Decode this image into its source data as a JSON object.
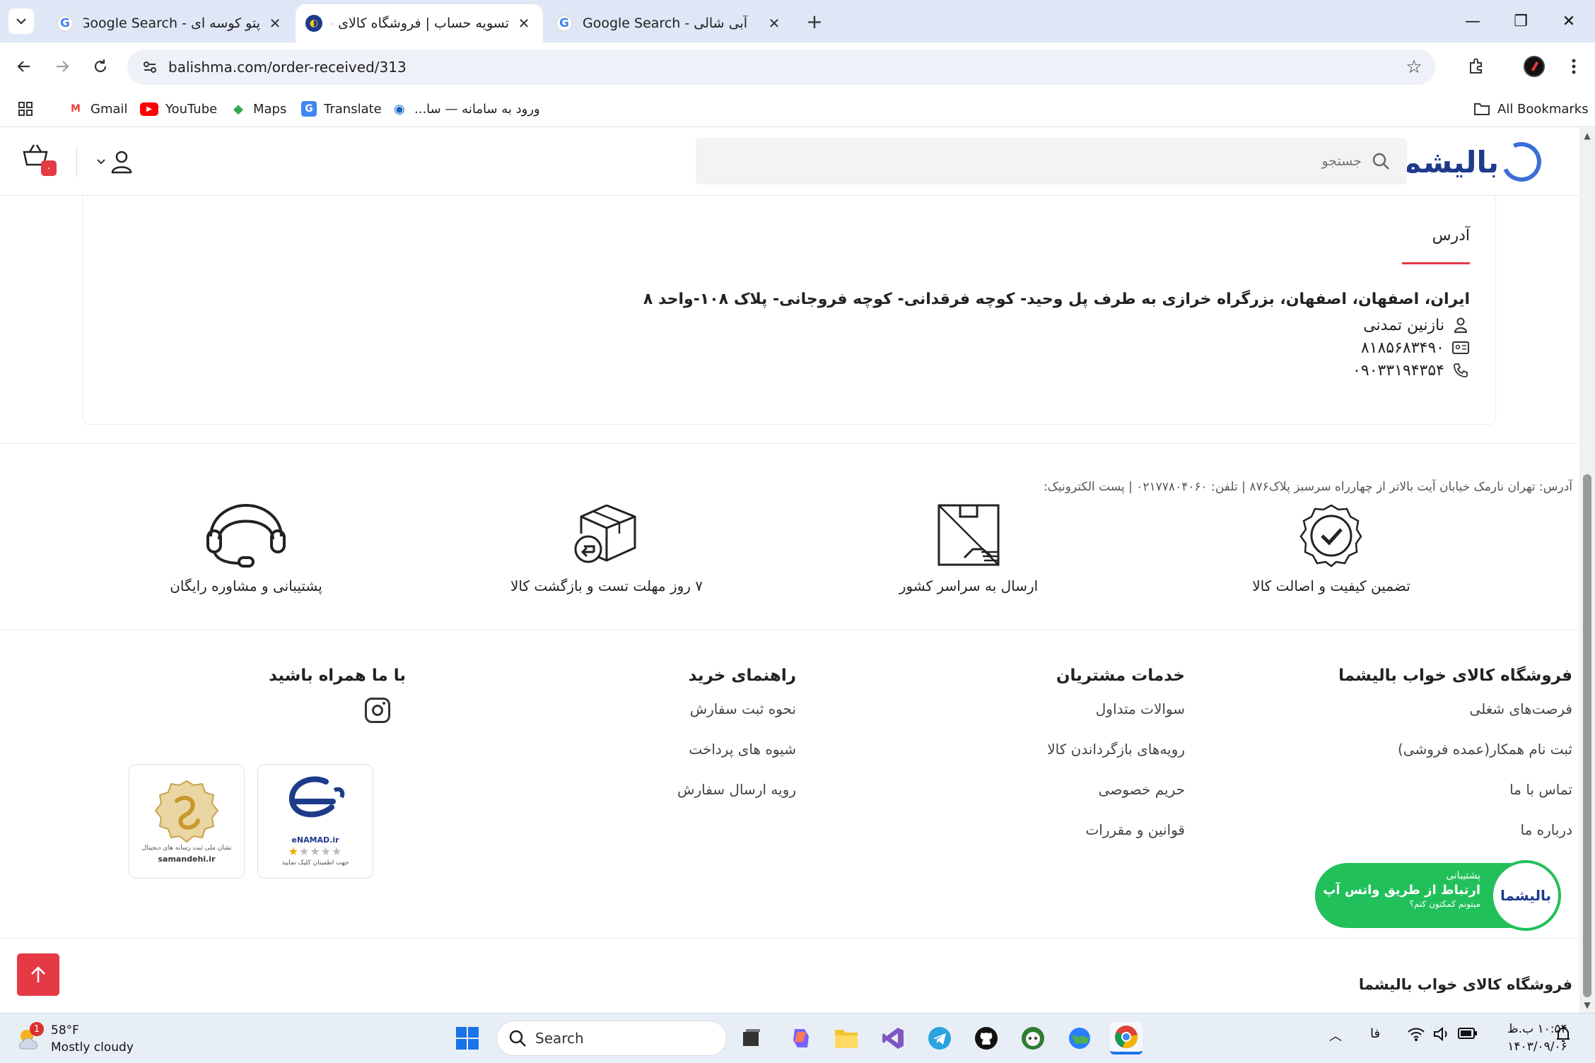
{
  "browser": {
    "tabs": [
      {
        "title": "پتو کوسه ای - Google Search",
        "icon": "google-icon"
      },
      {
        "title": "تسویه حساب | فروشگاه کالای خواب",
        "icon": "site-icon",
        "active": true
      },
      {
        "title": "آبی شالی - Google Search",
        "icon": "google-icon"
      }
    ],
    "url": "balishma.com/order-received/313",
    "bookmarks": [
      {
        "label": "Gmail"
      },
      {
        "label": "YouTube"
      },
      {
        "label": "Maps"
      },
      {
        "label": "Translate"
      },
      {
        "label": "ورود به سامانه — سا..."
      }
    ],
    "all_bookmarks": "All Bookmarks"
  },
  "site": {
    "logo_text": "بالیشما",
    "search_placeholder": "جستجو",
    "cart_count": "۰"
  },
  "address_card": {
    "title": "آدرس",
    "address_line": "ایران، اصفهان، اصفهان، بزرگراه خرازی به طرف پل وحید- کوچه فرقدانی- کوچه فروجانی- پلاک ۱۰۸-واحد ۸",
    "name": "نازنین تمدنی",
    "national_id": "۸۱۸۵۶۸۳۴۹۰",
    "phone": "۰۹۰۳۳۱۹۴۳۵۴"
  },
  "footer": {
    "contact_line": "آدرس: تهران نارمک خیابان آیت بالاتر از چهارراه سرسبز پلاک۸۷۶ | تلفن: ۰۲۱۷۷۸۰۴۰۶۰ | پست الکترونیک:",
    "features": [
      {
        "label": "تضمین کیفیت و اصالت کالا"
      },
      {
        "label": "ارسال به سراسر کشور"
      },
      {
        "label": "۷ روز مهلت تست و بازگشت کالا"
      },
      {
        "label": "پشتیبانی و مشاوره رایگان"
      }
    ],
    "columns": [
      {
        "title": "فروشگاه کالای خواب بالیشما",
        "links": [
          "فرصت‌های شغلی",
          "ثبت نام همکار(عمده فروشی)",
          "تماس با ما",
          "درباره ما"
        ]
      },
      {
        "title": "خدمات مشتریان",
        "links": [
          "سوالات متداول",
          "رویه‌های بازگرداندن کالا",
          "حریم خصوصی",
          "قوانین و مقررات"
        ]
      },
      {
        "title": "راهنمای خرید",
        "links": [
          "نحوه ثبت سفارش",
          "شیوه های پرداخت",
          "رویه ارسال سفارش"
        ]
      },
      {
        "title": "با ما همراه باشید",
        "links": []
      }
    ],
    "badges": {
      "enamad": "eNAMAD.ir",
      "enamad_sub": "جهت اطمینان کلیک نمایید",
      "samandehi": "samandehi.ir",
      "samandehi_sub": "نشان ملی ثبت رسانه های دیجیتال"
    },
    "whatsapp": {
      "line1": "پشتیبانی",
      "line2": "ارتباط از طریق واتس آپ",
      "line3": "میتونم کمکتون کنم؟",
      "logo": "بالیشما"
    },
    "bottom_title": "فروشگاه کالای خواب بالیشما"
  },
  "taskbar": {
    "weather_temp": "58°F",
    "weather_desc": "Mostly cloudy",
    "weather_badge": "1",
    "search_label": "Search",
    "lang": "فا",
    "time": "۱۰:۵۴ ب.ظ",
    "date": "۱۴۰۳/۰۹/۰۶"
  },
  "colors": {
    "accent_red": "#e53946",
    "brand_blue": "#1e3a8a",
    "whatsapp_green": "#22c05a"
  }
}
